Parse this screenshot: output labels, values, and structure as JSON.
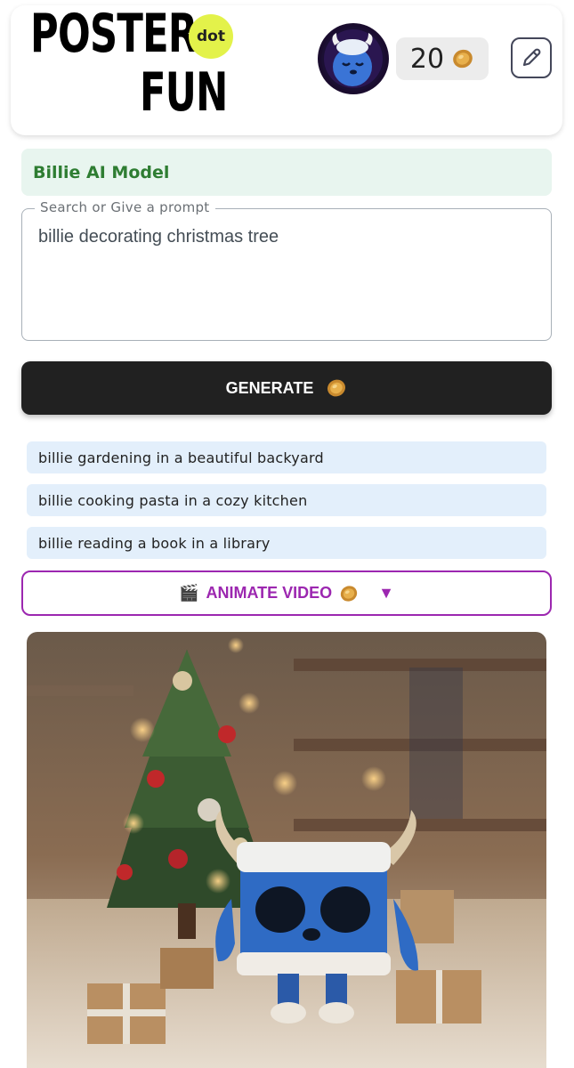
{
  "header": {
    "logo_word1": "POSTER",
    "logo_word2": "FUN",
    "logo_badge": "dot",
    "credits": "20",
    "credit_icon": "coin-icon",
    "edit_icon": "edit-icon"
  },
  "model": {
    "label": "Billie AI Model"
  },
  "prompt": {
    "legend": "Search or Give a prompt",
    "value": "billie decorating christmas tree"
  },
  "generate": {
    "label": "GENERATE"
  },
  "suggestions": [
    "billie gardening in a beautiful backyard",
    "billie cooking pasta in a cozy kitchen",
    "billie reading a book in a library"
  ],
  "animate": {
    "emoji": "🎬",
    "label": "ANIMATE VIDEO",
    "caret": "▼"
  },
  "colors": {
    "accent_purple": "#9c27b0",
    "model_green": "#2e7d32",
    "button_dark": "#212121",
    "suggestion_bg": "#e3effb"
  }
}
